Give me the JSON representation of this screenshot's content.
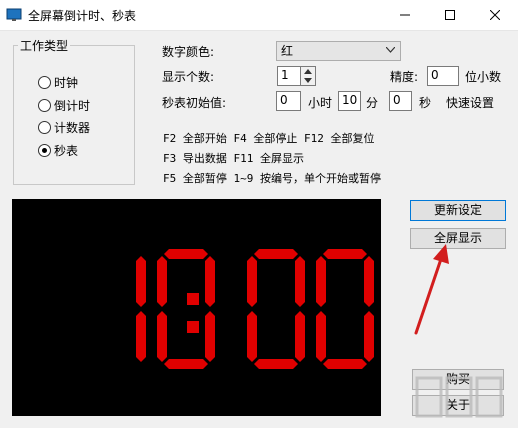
{
  "window": {
    "title": "全屏幕倒计时、秒表",
    "app_icon": "monitor-icon",
    "controls": [
      "minimize-icon",
      "maximize-icon",
      "close-icon"
    ]
  },
  "work_type": {
    "label": "工作类型",
    "options": [
      "时钟",
      "倒计时",
      "计数器",
      "秒表"
    ],
    "selected": "秒表"
  },
  "settings": {
    "digit_color_label": "数字颜色:",
    "digit_color_value": "红",
    "digit_count_label": "显示个数:",
    "digit_count_value": "1",
    "precision_label": "精度:",
    "precision_value": "0",
    "precision_unit": "位小数",
    "initial_label": "秒表初始值:",
    "hours_value": "0",
    "hours_unit": "小时",
    "minutes_value": "10",
    "minutes_unit": "分",
    "seconds_value": "0",
    "seconds_unit": "秒",
    "quick_setup": "快速设置"
  },
  "hints": [
    "F2 全部开始 F4 全部停止 F12 全部复位",
    "F3 导出数据 F11 全屏显示",
    "F5 全部暂停 1~9 按编号，单个开始或暂停"
  ],
  "display": {
    "time": "10:00",
    "digit_color": "#e00000",
    "background": "#000000"
  },
  "buttons": {
    "update": "更新设定",
    "fullscreen": "全屏显示",
    "buy": "购买",
    "about": "关于"
  },
  "annotation": {
    "arrow_color": "#d21e1e"
  },
  "colors": {
    "window_bg": "#f0f0f0",
    "focus_border": "#0078d7"
  }
}
